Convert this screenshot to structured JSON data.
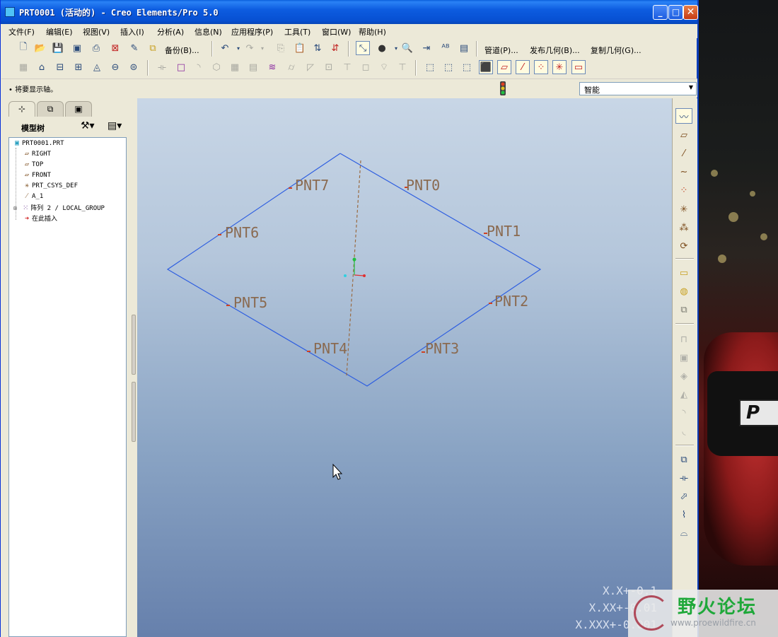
{
  "window": {
    "title": "PRT0001 (活动的) - Creo Elements/Pro 5.0",
    "buttons": {
      "minimize": "_",
      "maximize": "□",
      "close": "✕"
    }
  },
  "menu": [
    "文件(F)",
    "编辑(E)",
    "视图(V)",
    "插入(I)",
    "分析(A)",
    "信息(N)",
    "应用程序(P)",
    "工具(T)",
    "窗口(W)",
    "帮助(H)"
  ],
  "toolbar": {
    "backup_label": "备份(B)...",
    "pipe_label": "管道(P)...",
    "publish_label": "发布几何(B)...",
    "copy_label": "复制几何(G)..."
  },
  "status": {
    "message": "• 将要显示轴。",
    "filter_value": "智能"
  },
  "model_tree": {
    "title": "模型树",
    "items": [
      {
        "label": "PRT0001.PRT",
        "icon": "part-icon"
      },
      {
        "label": "RIGHT",
        "icon": "datum-plane-icon"
      },
      {
        "label": "TOP",
        "icon": "datum-plane-icon"
      },
      {
        "label": "FRONT",
        "icon": "datum-plane-icon"
      },
      {
        "label": "PRT_CSYS_DEF",
        "icon": "csys-icon"
      },
      {
        "label": "A_1",
        "icon": "axis-icon"
      },
      {
        "label": "阵列 2 / LOCAL_GROUP",
        "icon": "pattern-icon"
      },
      {
        "label": "在此插入",
        "icon": "insert-arrow-icon"
      }
    ]
  },
  "graphics": {
    "points": [
      "PNT0",
      "PNT1",
      "PNT2",
      "PNT3",
      "PNT4",
      "PNT5",
      "PNT6",
      "PNT7"
    ],
    "tolerances": [
      "X.X+-0.1",
      "X.XX+-0.01",
      "X.XXX+-0.001"
    ]
  },
  "watermark": {
    "cn": "野火论坛",
    "url": "www.proewildfire.cn"
  },
  "colors": {
    "titlebar": "#0750d2",
    "geometry_line": "#2f5fe0",
    "point_label": "#8a6a50",
    "axis_line": "#9a6a40"
  }
}
